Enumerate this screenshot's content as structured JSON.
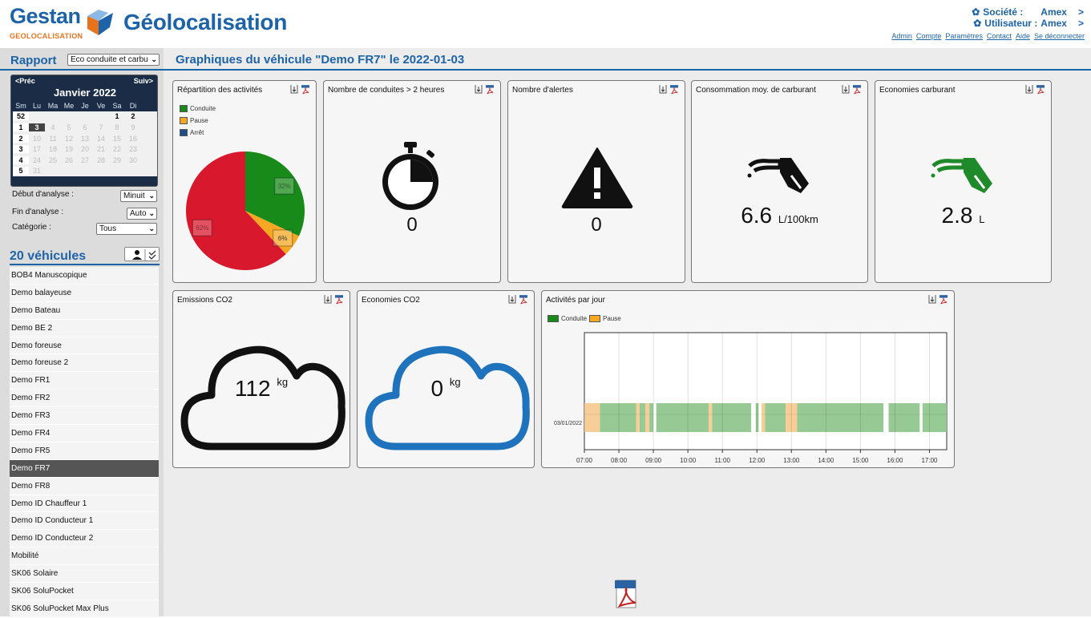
{
  "header": {
    "logo_name": "Gestan",
    "logo_sub": "GEOLOCALISATION",
    "app_title": "Géolocalisation",
    "societe_label": "Société :",
    "societe_value": "Amex",
    "utilisateur_label": "Utilisateur :",
    "utilisateur_value": "Amex",
    "chevron": ">",
    "links": [
      "Admin",
      "Compte",
      "Paramètres",
      "Contact",
      "Aide",
      "Se déconnecter"
    ],
    "colors": {
      "brand": "#1d63a8",
      "accent": "#e8731d"
    }
  },
  "rapport": {
    "label": "Rapport",
    "selected": "Eco conduite et carbu"
  },
  "page_title": "Graphiques du véhicule \"Demo FR7\" le 2022-01-03",
  "calendar": {
    "prev": "<Préc",
    "next": "Suiv>",
    "month": "Janvier 2022",
    "weekday_headers": [
      "Sm",
      "Lu",
      "Ma",
      "Me",
      "Je",
      "Ve",
      "Sa",
      "Di"
    ],
    "weeks": [
      {
        "week": "52",
        "days": [
          "",
          "",
          "",
          "",
          "",
          "1",
          "2"
        ]
      },
      {
        "week": "1",
        "days": [
          "3",
          "4",
          "5",
          "6",
          "7",
          "8",
          "9"
        ]
      },
      {
        "week": "2",
        "days": [
          "10",
          "11",
          "12",
          "13",
          "14",
          "15",
          "16"
        ]
      },
      {
        "week": "3",
        "days": [
          "17",
          "18",
          "19",
          "20",
          "21",
          "22",
          "23"
        ]
      },
      {
        "week": "4",
        "days": [
          "24",
          "25",
          "26",
          "27",
          "28",
          "29",
          "30"
        ]
      },
      {
        "week": "5",
        "days": [
          "31",
          "",
          "",
          "",
          "",
          "",
          ""
        ]
      }
    ],
    "selected_day": "3"
  },
  "filters": {
    "debut_label": "Début d'analyse :",
    "debut_value": "Minuit",
    "fin_label": "Fin d'analyse :",
    "fin_value": "Auto",
    "categorie_label": "Catégorie :",
    "categorie_value": "Tous"
  },
  "vehicles": {
    "count_label": "20 véhicules",
    "items": [
      "BOB4 Manuscopique",
      "Demo balayeuse",
      "Demo Bateau",
      "Demo BE 2",
      "Demo foreuse",
      "Demo foreuse 2",
      "Demo FR1",
      "Demo FR2",
      "Demo FR3",
      "Demo FR4",
      "Demo FR5",
      "Demo FR7",
      "Demo FR8",
      "Demo ID Chauffeur 1",
      "Demo ID Conducteur 1",
      "Demo ID Conducteur 2",
      "Mobilité",
      "SK06 Solaire",
      "SK06 SoluPocket",
      "SK06 SoluPocket Max Plus"
    ],
    "selected": "Demo FR7"
  },
  "cards": {
    "repartition": {
      "title": "Répartition des activités"
    },
    "conduites": {
      "title": "Nombre de conduites > 2 heures",
      "value": "0"
    },
    "alertes": {
      "title": "Nombre d'alertes",
      "value": "0"
    },
    "consommation": {
      "title": "Consommation moy. de carburant",
      "value": "6.6",
      "unit": "L/100km"
    },
    "economies_carb": {
      "title": "Economies carburant",
      "value": "2.8",
      "unit": "L"
    },
    "emissions": {
      "title": "Emissions CO2",
      "value": "112",
      "unit": "kg"
    },
    "economies_co2": {
      "title": "Economies CO2",
      "value": "0",
      "unit": "kg"
    },
    "activites": {
      "title": "Activités par jour"
    }
  },
  "chart_data": [
    {
      "type": "pie",
      "legend": [
        "Conduite",
        "Pause",
        "Arrêt"
      ],
      "colors": [
        "#188a1a",
        "#f7a823",
        "#d8182c"
      ],
      "slices": [
        {
          "name": "Conduite",
          "value": 32,
          "label": "32%"
        },
        {
          "name": "Pause",
          "value": 6,
          "label": "6%"
        },
        {
          "name": "Arrêt",
          "value": 62,
          "label": "62%"
        }
      ],
      "legend_position": "top-left"
    },
    {
      "type": "bar",
      "legend": [
        "Conduite",
        "Pause"
      ],
      "colors": {
        "Conduite": "#97c994",
        "Pause": "#f7cd98"
      },
      "y_categories": [
        "03/01/2022"
      ],
      "x_ticks": [
        "07:00",
        "08:00",
        "09:00",
        "10:00",
        "11:00",
        "12:00",
        "13:00",
        "14:00",
        "15:00",
        "16:00",
        "17:00"
      ],
      "xlim": [
        "07:00",
        "17:30"
      ],
      "grid": true,
      "segments": [
        {
          "kind": "Pause",
          "start": "07:00",
          "end": "07:27"
        },
        {
          "kind": "Conduite",
          "start": "07:27",
          "end": "08:30"
        },
        {
          "kind": "Pause",
          "start": "08:30",
          "end": "08:36"
        },
        {
          "kind": "Conduite",
          "start": "08:36",
          "end": "08:46"
        },
        {
          "kind": "Pause",
          "start": "08:46",
          "end": "08:53"
        },
        {
          "kind": "Conduite",
          "start": "08:53",
          "end": "09:00"
        },
        {
          "kind": "Conduite",
          "start": "09:05",
          "end": "10:36"
        },
        {
          "kind": "Pause",
          "start": "10:36",
          "end": "10:42"
        },
        {
          "kind": "Conduite",
          "start": "10:42",
          "end": "11:50"
        },
        {
          "kind": "Conduite",
          "start": "11:58",
          "end": "12:03"
        },
        {
          "kind": "Pause",
          "start": "12:08",
          "end": "12:14"
        },
        {
          "kind": "Conduite",
          "start": "12:14",
          "end": "12:50"
        },
        {
          "kind": "Pause",
          "start": "12:50",
          "end": "13:10"
        },
        {
          "kind": "Conduite",
          "start": "13:10",
          "end": "15:40"
        },
        {
          "kind": "Conduite",
          "start": "15:49",
          "end": "16:43"
        },
        {
          "kind": "Conduite",
          "start": "16:48",
          "end": "17:30"
        }
      ]
    }
  ]
}
